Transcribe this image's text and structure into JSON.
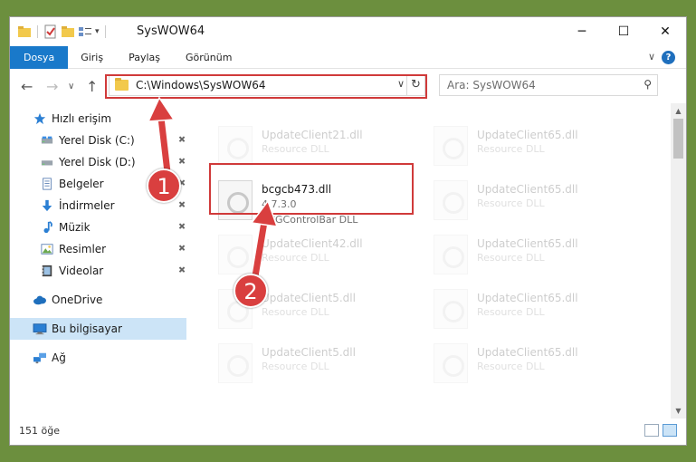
{
  "window": {
    "title": "SysWOW64",
    "controls": {
      "minimize": "─",
      "maximize": "☐",
      "close": "✕"
    }
  },
  "ribbon": {
    "tabs": [
      "Dosya",
      "Giriş",
      "Paylaş",
      "Görünüm"
    ],
    "active_tab": "Dosya",
    "expand_icon": "∨",
    "help_icon": "?"
  },
  "navigation": {
    "back": "←",
    "forward": "→",
    "recent": "∨",
    "up": "↑"
  },
  "address_bar": {
    "path": "C:\\Windows\\SysWOW64",
    "dropdown": "∨",
    "refresh": "↻"
  },
  "search": {
    "placeholder": "Ara: SysWOW64",
    "icon": "⚲"
  },
  "sidebar": {
    "quick_access": "Hızlı erişim",
    "items": [
      {
        "label": "Yerel Disk (C:)",
        "icon": "drive-icon",
        "pinned": true
      },
      {
        "label": "Yerel Disk (D:)",
        "icon": "drive-icon",
        "pinned": true
      },
      {
        "label": "Belgeler",
        "icon": "documents-icon",
        "pinned": true
      },
      {
        "label": "İndirmeler",
        "icon": "download-icon",
        "pinned": true
      },
      {
        "label": "Müzik",
        "icon": "music-icon",
        "pinned": true
      },
      {
        "label": "Resimler",
        "icon": "pictures-icon",
        "pinned": true
      },
      {
        "label": "Videolar",
        "icon": "video-icon",
        "pinned": true
      }
    ],
    "onedrive": "OneDrive",
    "this_pc": "Bu bilgisayar",
    "network": "Ağ",
    "pin_glyph": "📌"
  },
  "files": {
    "highlighted": {
      "name": "bcgcb473.dll",
      "version": "4.7.3.0",
      "description": "BCGControlBar DLL"
    },
    "left": [
      {
        "name": "UpdateClient21.dll",
        "type": "Resource DLL"
      },
      {
        "name": "UpdateClient42.dll",
        "type": "Resource DLL"
      },
      {
        "name": "UpdateClient5.dll",
        "type": "Resource DLL"
      },
      {
        "name": "UpdateClient5.dll",
        "type": "Resource DLL"
      }
    ],
    "right": [
      {
        "name": "UpdateClient65.dll",
        "type": "Resource DLL"
      },
      {
        "name": "UpdateClient65.dll",
        "type": "Resource DLL"
      },
      {
        "name": "UpdateClient65.dll",
        "type": "Resource DLL"
      },
      {
        "name": "UpdateClient65.dll",
        "type": "Resource DLL"
      },
      {
        "name": "UpdateClient65.dll",
        "type": "Resource DLL"
      }
    ]
  },
  "status_bar": {
    "count": "151 öğe"
  },
  "annotations": {
    "step1": "1",
    "step2": "2"
  },
  "colors": {
    "accent": "#1979ca",
    "highlight_box": "#d03a3a",
    "badge": "#d93f3f",
    "selection": "#cce4f7"
  }
}
